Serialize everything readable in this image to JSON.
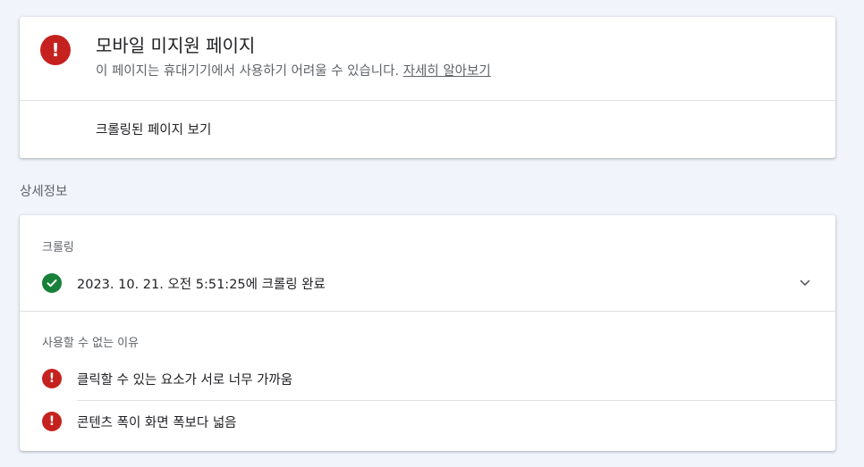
{
  "status": {
    "icon": "error-icon",
    "title": "모바일 미지원 페이지",
    "description": "이 페이지는 휴대기기에서 사용하기 어려울 수 있습니다.",
    "learn_more": "자세히 알아보기",
    "view_crawled": "크롤링된 페이지 보기"
  },
  "details": {
    "section_title": "상세정보",
    "crawl": {
      "label": "크롤링",
      "icon": "check-circle-icon",
      "text": "2023. 10. 21. 오전 5:51:25에 크롤링 완료"
    },
    "reasons": {
      "label": "사용할 수 없는 이유",
      "items": [
        {
          "icon": "error-icon",
          "text": "클릭할 수 있는 요소가 서로 너무 가까움"
        },
        {
          "icon": "error-icon",
          "text": "콘텐츠 폭이 화면 폭보다 넓음"
        }
      ]
    }
  },
  "colors": {
    "error": "#c5221f",
    "success": "#188038",
    "background": "#f1f4fb"
  }
}
